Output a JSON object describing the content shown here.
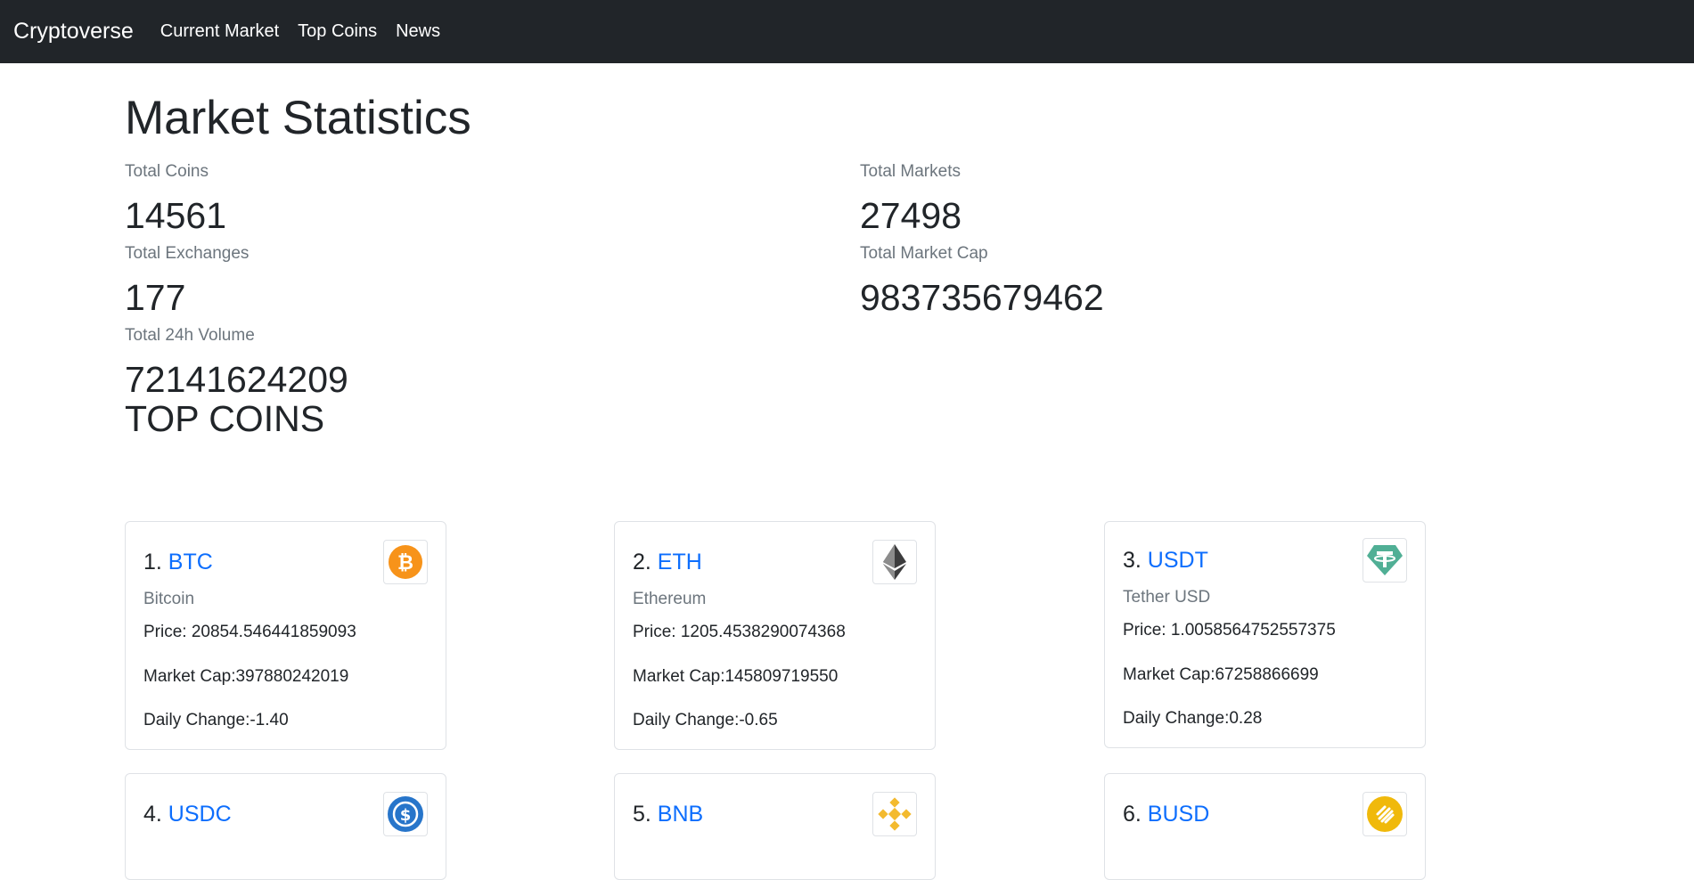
{
  "navbar": {
    "brand": "Cryptoverse",
    "links": [
      "Current Market",
      "Top Coins",
      "News"
    ]
  },
  "stats": {
    "title": "Market Statistics",
    "total_coins": {
      "label": "Total Coins",
      "value": "14561"
    },
    "total_markets": {
      "label": "Total Markets",
      "value": "27498"
    },
    "total_exchanges": {
      "label": "Total Exchanges",
      "value": "177"
    },
    "total_market_cap": {
      "label": "Total Market Cap",
      "value": "983735679462"
    },
    "total_24h_volume": {
      "label": "Total 24h Volume",
      "value": "72141624209"
    }
  },
  "top_coins": {
    "title": "TOP COINS",
    "coins": [
      {
        "rank": "1. ",
        "symbol": "BTC",
        "name": "Bitcoin",
        "price": "Price: 20854.546441859093",
        "market_cap": "Market Cap:397880242019",
        "daily_change": "Daily Change:-1.40",
        "icon": "bitcoin-icon",
        "color": "#f7931a"
      },
      {
        "rank": "2. ",
        "symbol": "ETH",
        "name": "Ethereum",
        "price": "Price: 1205.4538290074368",
        "market_cap": "Market Cap:145809719550",
        "daily_change": "Daily Change:-0.65",
        "icon": "ethereum-icon",
        "color": "#3c3c3d"
      },
      {
        "rank": "3. ",
        "symbol": "USDT",
        "name": "Tether USD",
        "price": "Price: 1.0058564752557375",
        "market_cap": "Market Cap:67258866699",
        "daily_change": "Daily Change:0.28",
        "icon": "tether-icon",
        "color": "#50af95"
      },
      {
        "rank": "4. ",
        "symbol": "USDC",
        "icon": "usdc-icon",
        "color": "#2775ca"
      },
      {
        "rank": "5. ",
        "symbol": "BNB",
        "icon": "bnb-icon",
        "color": "#f3ba2f"
      },
      {
        "rank": "6. ",
        "symbol": "BUSD",
        "icon": "busd-icon",
        "color": "#f0b90b"
      }
    ]
  }
}
